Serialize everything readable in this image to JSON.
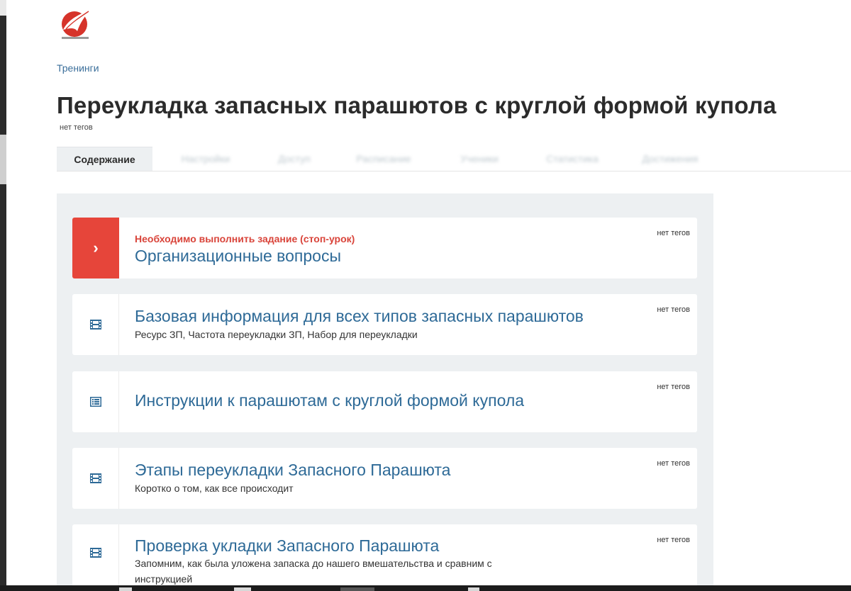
{
  "breadcrumb": "Тренинги",
  "title": "Переукладка запасных парашютов с круглой формой купола",
  "title_tags": "нет тегов",
  "tabs": [
    {
      "label": "Содержание"
    },
    {
      "label": "Настройки"
    },
    {
      "label": "Доступ"
    },
    {
      "label": "Расписание"
    },
    {
      "label": "Ученики"
    },
    {
      "label": "Статистика"
    },
    {
      "label": "Достижения"
    }
  ],
  "lessons": [
    {
      "warning": "Необходимо выполнить задание (стоп-урок)",
      "title": "Организационные вопросы",
      "subtitle": "",
      "tags": "нет тегов",
      "icon": "chevron-right-icon"
    },
    {
      "warning": "",
      "title": "Базовая информация для всех типов запасных парашютов",
      "subtitle": "Ресурс ЗП, Частота переукладки ЗП, Набор для переукладки",
      "tags": "нет тегов",
      "icon": "film-icon"
    },
    {
      "warning": "",
      "title": "Инструкции к парашютам с круглой формой купола",
      "subtitle": "",
      "tags": "нет тегов",
      "icon": "document-list-icon"
    },
    {
      "warning": "",
      "title": "Этапы переукладки Запасного Парашюта",
      "subtitle": "Коротко о том, как все происходит",
      "tags": "нет тегов",
      "icon": "film-icon"
    },
    {
      "warning": "",
      "title": "Проверка укладки Запасного Парашюта",
      "subtitle": "Запомним, как была уложена запаска до нашего вмешательства и сравним с инструкцией",
      "tags": "нет тегов",
      "icon": "film-icon"
    }
  ],
  "colors": {
    "accent_red": "#e6453a",
    "link_blue": "#2e6a97",
    "content_bg": "#edf0f2"
  }
}
